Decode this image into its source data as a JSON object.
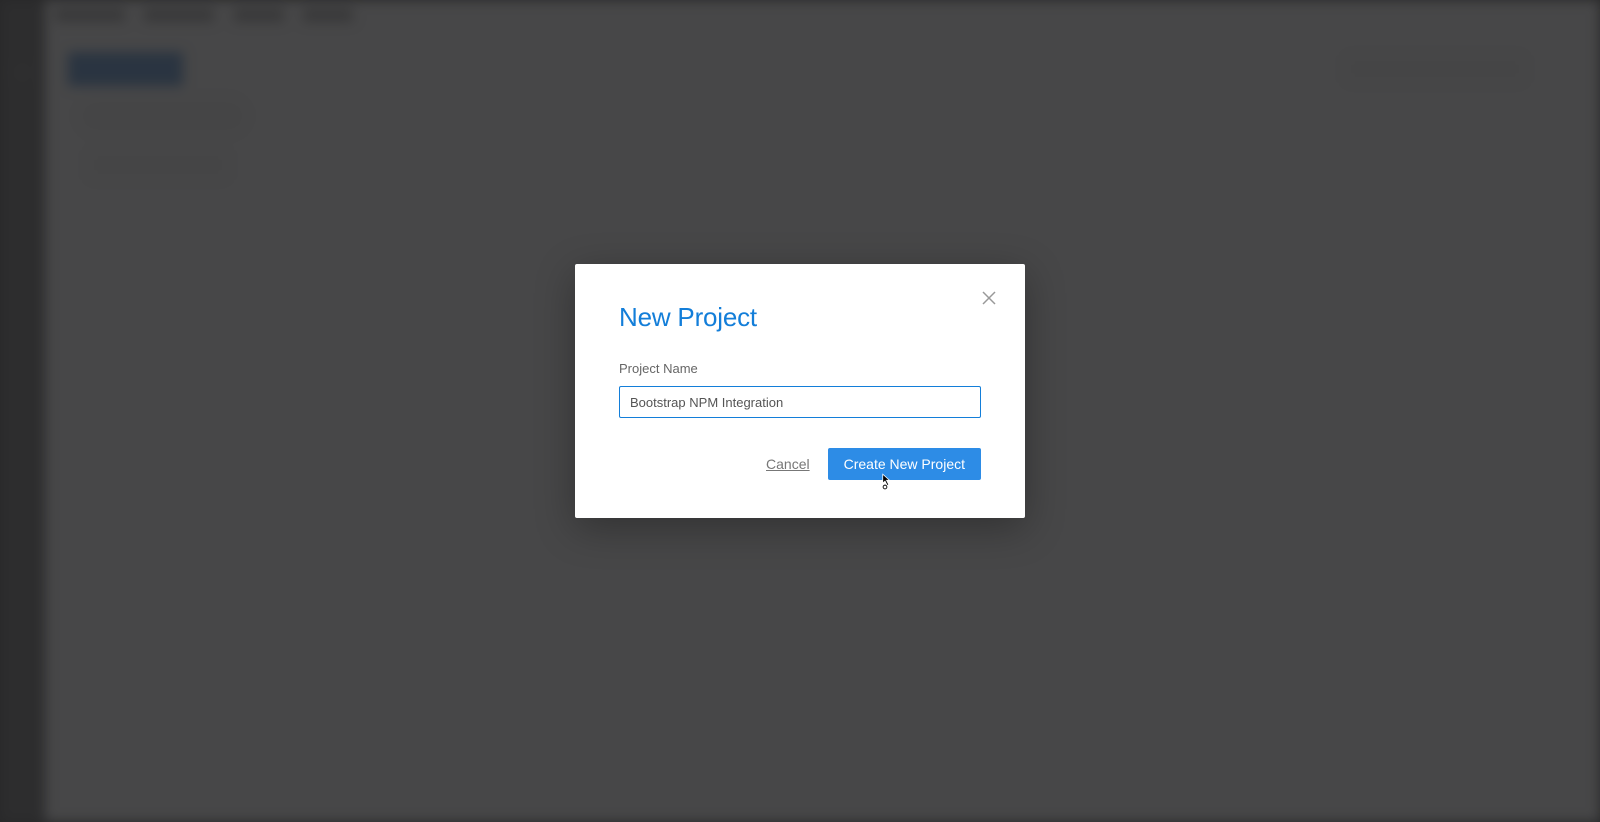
{
  "modal": {
    "title": "New Project",
    "field_label": "Project Name",
    "input_value": "Bootstrap NPM Integration",
    "cancel_label": "Cancel",
    "submit_label": "Create New Project"
  }
}
